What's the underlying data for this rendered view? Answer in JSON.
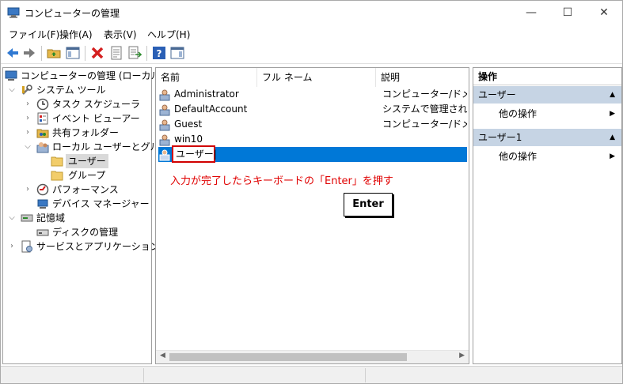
{
  "window": {
    "title": "コンピューターの管理"
  },
  "window_controls": {
    "minimize": "—",
    "maximize": "☐",
    "close": "✕"
  },
  "menu": [
    "ファイル(F)",
    "操作(A)",
    "表示(V)",
    "ヘルプ(H)"
  ],
  "tree": [
    {
      "label": "コンピューターの管理 (ローカル)",
      "icon": "computer-management-icon"
    },
    {
      "label": "システム ツール",
      "icon": "tools-icon"
    },
    {
      "label": "タスク スケジューラ",
      "icon": "clock-icon"
    },
    {
      "label": "イベント ビューアー",
      "icon": "event-viewer-icon"
    },
    {
      "label": "共有フォルダー",
      "icon": "shared-folder-icon"
    },
    {
      "label": "ローカル ユーザーとグループ",
      "icon": "users-groups-icon"
    },
    {
      "label": "ユーザー",
      "icon": "folder-icon"
    },
    {
      "label": "グループ",
      "icon": "folder-icon"
    },
    {
      "label": "パフォーマンス",
      "icon": "performance-icon"
    },
    {
      "label": "デバイス マネージャー",
      "icon": "device-manager-icon"
    },
    {
      "label": "記憶域",
      "icon": "storage-icon"
    },
    {
      "label": "ディスクの管理",
      "icon": "disk-icon"
    },
    {
      "label": "サービスとアプリケーション",
      "icon": "services-icon"
    }
  ],
  "list": {
    "columns": [
      "名前",
      "フル ネーム",
      "説明"
    ],
    "rows": [
      {
        "name": "Administrator",
        "description": "コンピューター/ドメインの管"
      },
      {
        "name": "DefaultAccount",
        "description": "システムで管理されるユー"
      },
      {
        "name": "Guest",
        "description": "コンピューター/ドメインへの"
      },
      {
        "name": "win10",
        "description": ""
      }
    ],
    "editing_value": "ユーザー",
    "note": "入力が完了したらキーボードの「Enter」を押す",
    "key_label": "Enter"
  },
  "actions": {
    "header": "操作",
    "sections": [
      {
        "title": "ユーザー",
        "item": "他の操作"
      },
      {
        "title": "ユーザー1",
        "item": "他の操作"
      }
    ]
  },
  "colors": {
    "selection": "#0078d7",
    "annotation": "#e00000",
    "section_bg": "#c6d4e4"
  }
}
